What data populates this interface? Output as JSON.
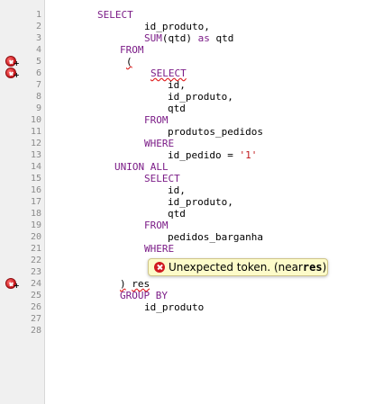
{
  "editor": {
    "lines": [
      {
        "n": "1",
        "segments": [
          {
            "t": "SELECT",
            "c": "kw"
          }
        ]
      },
      {
        "n": "2",
        "segments": [
          {
            "t": "id_produto,",
            "c": ""
          }
        ]
      },
      {
        "n": "3",
        "segments": [
          {
            "t": "SUM",
            "c": "kw"
          },
          {
            "t": "(qtd) ",
            "c": ""
          },
          {
            "t": "as",
            "c": "kw"
          },
          {
            "t": " qtd",
            "c": ""
          }
        ]
      },
      {
        "n": "4",
        "segments": [
          {
            "t": "FROM",
            "c": "kw"
          }
        ]
      },
      {
        "n": "5",
        "segments": [
          {
            "t": "(",
            "c": "err"
          }
        ]
      },
      {
        "n": "6",
        "segments": [
          {
            "t": "SELECT",
            "c": "kw err"
          }
        ]
      },
      {
        "n": "7",
        "segments": [
          {
            "t": "id,",
            "c": ""
          }
        ]
      },
      {
        "n": "8",
        "segments": [
          {
            "t": "id_produto,",
            "c": ""
          }
        ]
      },
      {
        "n": "9",
        "segments": [
          {
            "t": "qtd",
            "c": ""
          }
        ]
      },
      {
        "n": "10",
        "segments": [
          {
            "t": "FROM",
            "c": "kw"
          }
        ]
      },
      {
        "n": "11",
        "segments": [
          {
            "t": "produtos_pedidos",
            "c": ""
          }
        ]
      },
      {
        "n": "12",
        "segments": [
          {
            "t": "WHERE",
            "c": "kw"
          }
        ]
      },
      {
        "n": "13",
        "segments": [
          {
            "t": "id_pedido = ",
            "c": ""
          },
          {
            "t": "'1'",
            "c": "str"
          }
        ]
      },
      {
        "n": "14",
        "segments": [
          {
            "t": "UNION ALL",
            "c": "kw"
          }
        ]
      },
      {
        "n": "15",
        "segments": [
          {
            "t": "SELECT",
            "c": "kw"
          }
        ]
      },
      {
        "n": "16",
        "segments": [
          {
            "t": "id,",
            "c": ""
          }
        ]
      },
      {
        "n": "17",
        "segments": [
          {
            "t": "id_produto,",
            "c": ""
          }
        ]
      },
      {
        "n": "18",
        "segments": [
          {
            "t": "qtd",
            "c": ""
          }
        ]
      },
      {
        "n": "19",
        "segments": [
          {
            "t": "FROM",
            "c": "kw"
          }
        ]
      },
      {
        "n": "20",
        "segments": [
          {
            "t": "pedidos_barganha",
            "c": ""
          }
        ]
      },
      {
        "n": "21",
        "segments": [
          {
            "t": "WHERE",
            "c": "kw"
          }
        ]
      },
      {
        "n": "22",
        "segments": []
      },
      {
        "n": "23",
        "segments": []
      },
      {
        "n": "24",
        "segments": [
          {
            "t": ")",
            "c": "err"
          },
          {
            "t": " ",
            "c": ""
          },
          {
            "t": "res",
            "c": "err"
          }
        ]
      },
      {
        "n": "25",
        "segments": [
          {
            "t": "GROUP BY",
            "c": "kw"
          }
        ]
      },
      {
        "n": "26",
        "segments": [
          {
            "t": "id_produto",
            "c": ""
          }
        ]
      },
      {
        "n": "27",
        "segments": []
      },
      {
        "n": "28",
        "segments": []
      }
    ],
    "error_lines": [
      "5",
      "6",
      "24"
    ]
  },
  "tooltip": {
    "message": "Unexpected token. (near ",
    "token": "res",
    "suffix": ")"
  },
  "colors": {
    "keyword": "#7b1c87",
    "string": "#c1191c",
    "error": "#d0191f",
    "tooltip_bg": "#fdfbc9"
  }
}
